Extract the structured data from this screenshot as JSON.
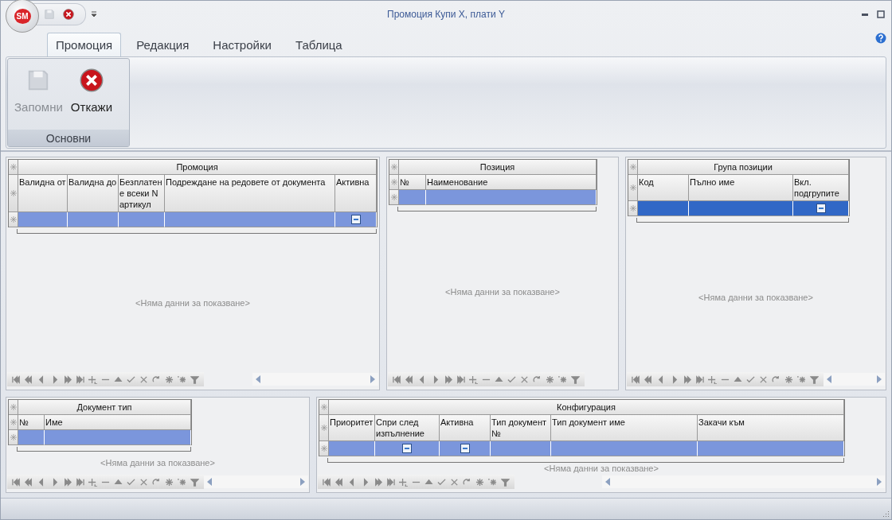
{
  "window": {
    "title": "Промоция Купи X, плати Y",
    "logo": "SM"
  },
  "quick_access": [
    {
      "kind": "save",
      "disabled": true
    },
    {
      "kind": "cancel",
      "disabled": false
    }
  ],
  "tabs": [
    {
      "label": "Промоция",
      "selected": true
    },
    {
      "label": "Редакция",
      "selected": false
    },
    {
      "label": "Настройки",
      "selected": false
    },
    {
      "label": "Таблица",
      "selected": false
    }
  ],
  "ribbon_groups": [
    {
      "label": "Основни",
      "buttons": [
        {
          "label": "Запомни",
          "kind": "save",
          "disabled": true
        },
        {
          "label": "Откажи",
          "kind": "cancel",
          "disabled": false
        }
      ]
    }
  ],
  "grids": [
    {
      "title": "Промоция",
      "focused_row": false,
      "empty_text": "<Няма данни за показване>",
      "columns": [
        {
          "label": "Валидна от",
          "kind": "text"
        },
        {
          "label": "Валидна до",
          "kind": "text"
        },
        {
          "label": "Безплатен е всеки N артикул",
          "kind": "text"
        },
        {
          "label": "Подреждане на редовете от документа",
          "kind": "text"
        },
        {
          "label": "Активна",
          "kind": "checkbox",
          "indeterminate": true
        }
      ]
    },
    {
      "title": "Позиция",
      "focused_row": false,
      "empty_text": "<Няма данни за показване>",
      "columns": [
        {
          "label": "№",
          "kind": "text"
        },
        {
          "label": "Наименование",
          "kind": "text"
        }
      ]
    },
    {
      "title": "Група позиции",
      "focused_row": true,
      "empty_text": "<Няма данни за показване>",
      "columns": [
        {
          "label": "Код",
          "kind": "text"
        },
        {
          "label": "Пълно име",
          "kind": "text"
        },
        {
          "label": "Вкл. подгрупите",
          "kind": "checkbox",
          "indeterminate": true
        }
      ]
    },
    {
      "title": "Документ тип",
      "focused_row": false,
      "empty_text": "<Няма данни за показване>",
      "columns": [
        {
          "label": "№",
          "kind": "text"
        },
        {
          "label": "Име",
          "kind": "text"
        }
      ]
    },
    {
      "title": "Конфигурация",
      "focused_row": false,
      "empty_text": "<Няма данни за показване>",
      "columns": [
        {
          "label": "Приоритет",
          "kind": "text"
        },
        {
          "label": "Спри след изпълнение",
          "kind": "checkbox",
          "indeterminate": true
        },
        {
          "label": "Активна",
          "kind": "checkbox",
          "indeterminate": true
        },
        {
          "label": "Тип документ №",
          "kind": "text"
        },
        {
          "label": "Тип документ име",
          "kind": "text"
        },
        {
          "label": "Закачи към",
          "kind": "text"
        }
      ]
    }
  ]
}
